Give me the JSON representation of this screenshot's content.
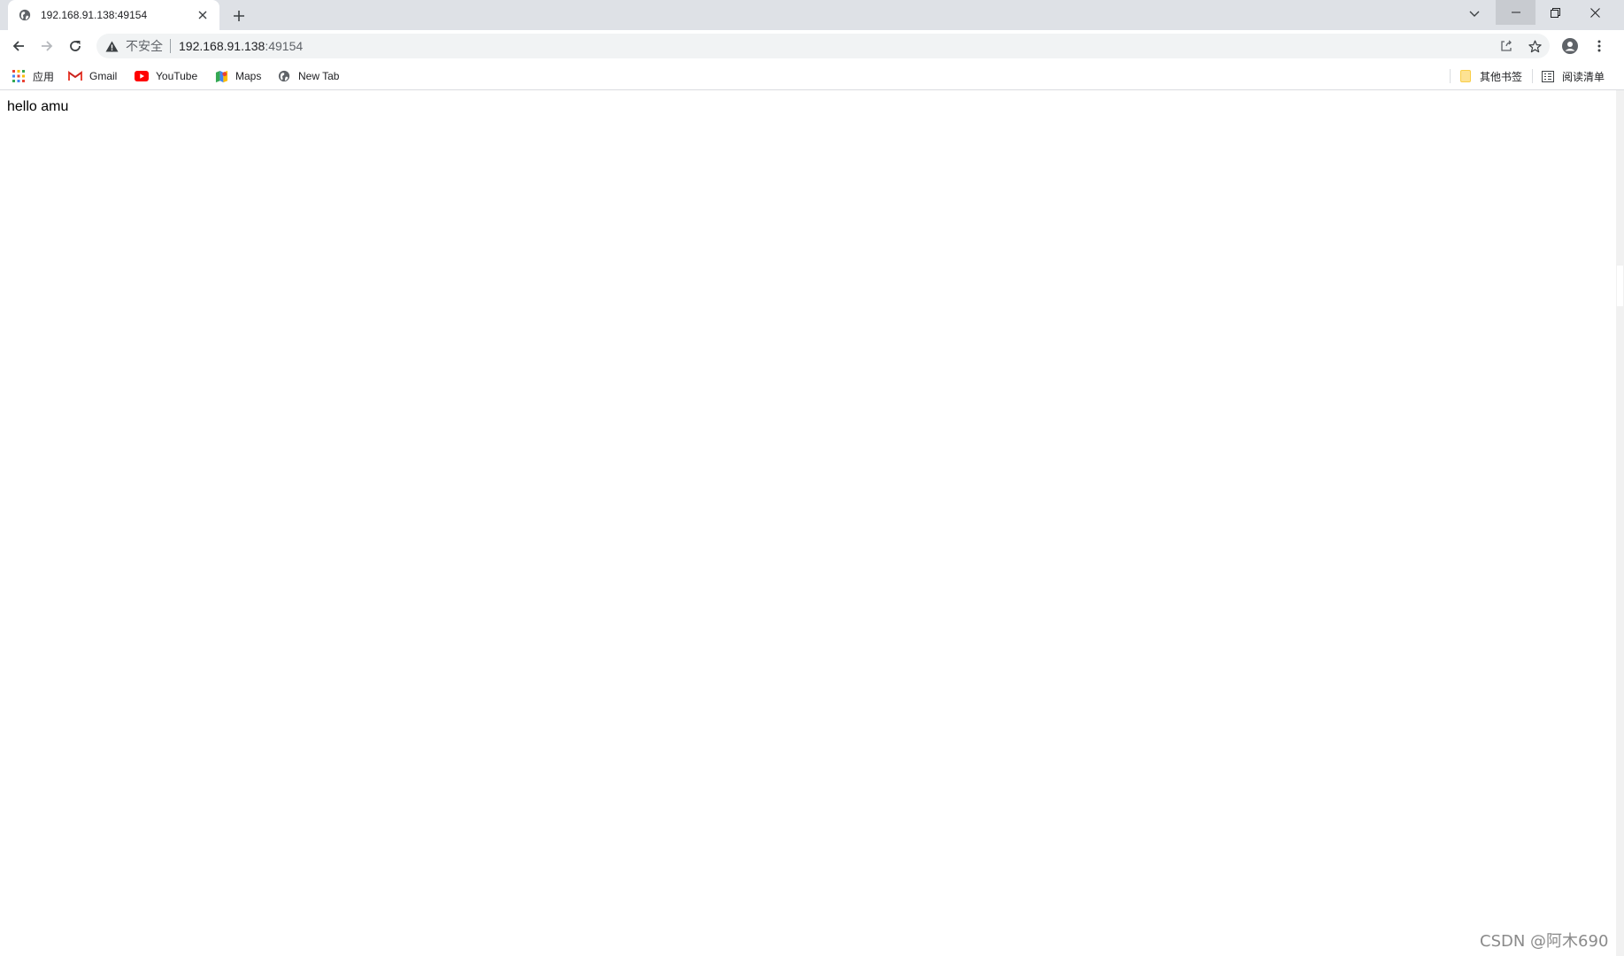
{
  "browser": {
    "tab": {
      "title": "192.168.91.138:49154"
    },
    "address_bar": {
      "security_label": "不安全",
      "host": "192.168.91.138",
      "port": ":49154"
    },
    "bookmarks": [
      {
        "label": "应用",
        "icon": "apps-grid-icon"
      },
      {
        "label": "Gmail",
        "icon": "gmail-icon"
      },
      {
        "label": "YouTube",
        "icon": "youtube-icon"
      },
      {
        "label": "Maps",
        "icon": "maps-icon"
      },
      {
        "label": "New Tab",
        "icon": "globe-icon"
      }
    ],
    "other_bookmarks": {
      "label": "其他书签",
      "icon": "folder-icon"
    },
    "reading_list": {
      "label": "阅读清单",
      "icon": "reading-list-icon"
    }
  },
  "page": {
    "body_text": "hello amu"
  },
  "watermark": "CSDN @阿木690",
  "colors": {
    "tabstrip_bg": "#dee1e6",
    "omnibox_bg": "#f1f3f4",
    "youtube_red": "#ff0000",
    "gmail_red": "#ea4335"
  }
}
